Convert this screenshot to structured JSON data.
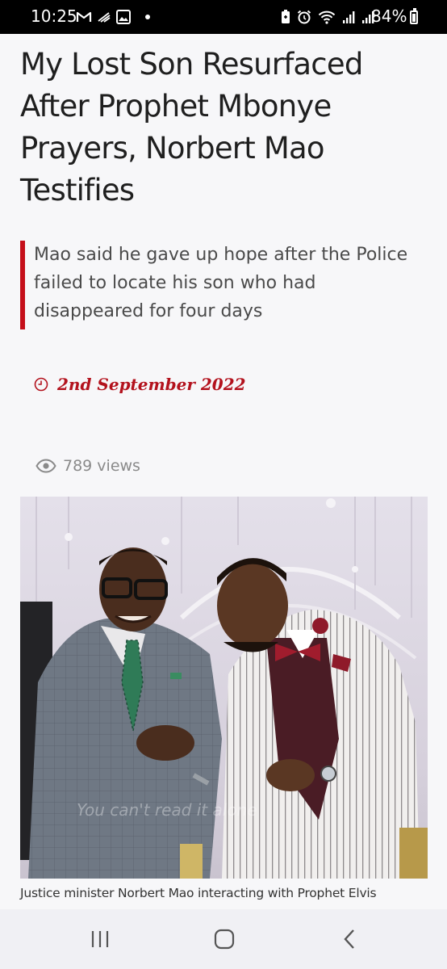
{
  "status_bar": {
    "time": "10:25",
    "battery_percent": "84%",
    "left_icons": [
      "gmail-icon",
      "signal-boost-icon",
      "gallery-icon",
      "notification-dot"
    ],
    "right_icons": [
      "battery-saver-icon",
      "alarm-icon",
      "wifi-icon",
      "signal-icon",
      "signal-icon"
    ]
  },
  "article": {
    "title": "My Lost Son Resurfaced After Prophet Mbonye Prayers, Norbert Mao Testifies",
    "excerpt": "Mao said he gave up hope after the Police failed to locate his son who had disappeared for four days",
    "date": "2nd September 2022",
    "views": "789 views",
    "photo_watermark": "You can't read it alone",
    "photo_caption": "Justice minister Norbert Mao interacting with Prophet Elvis"
  },
  "colors": {
    "accent": "#c50f1a",
    "date": "#b3121d",
    "background": "#f7f7f9",
    "headline": "#1f1f1f"
  },
  "nav_bar": {
    "buttons": [
      "recent-apps",
      "home",
      "back"
    ]
  }
}
